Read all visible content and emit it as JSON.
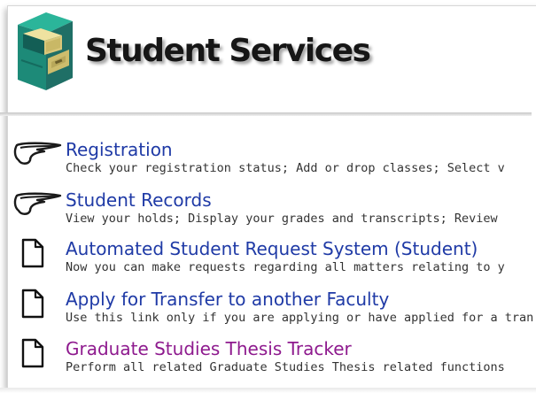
{
  "header": {
    "title": "Student Services",
    "logo_icon": "file-cabinet-icon"
  },
  "items": [
    {
      "title": "Registration",
      "description": "Check your registration status; Add or drop classes; Select v",
      "icon": "menu-arrow-icon",
      "visited": false
    },
    {
      "title": "Student Records",
      "description": "View your holds; Display your grades and transcripts; Review",
      "icon": "menu-arrow-icon",
      "visited": false
    },
    {
      "title": "Automated Student Request System (Student)",
      "description": "Now you can make requests regarding all matters relating to y",
      "icon": "document-icon",
      "visited": false
    },
    {
      "title": "Apply for Transfer to another Faculty",
      "description": "Use this link only if you are applying or have applied for a tran",
      "icon": "document-icon",
      "visited": false
    },
    {
      "title": "Graduate Studies Thesis Tracker",
      "description": "Perform all related Graduate Studies Thesis related functions",
      "icon": "document-icon",
      "visited": true
    }
  ],
  "colors": {
    "link": "#1f3aa6",
    "link_visited": "#8e1a8e",
    "description": "#333333"
  }
}
